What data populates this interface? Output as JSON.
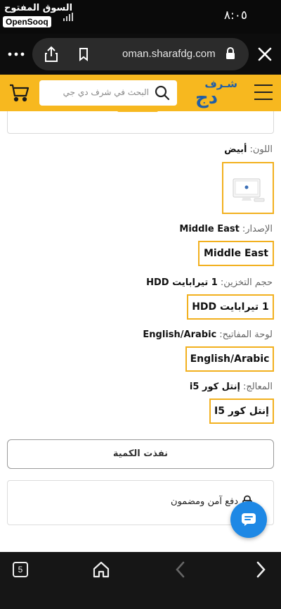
{
  "status_bar": {
    "watermark_arabic": "السوق المفتوح",
    "watermark_english": "OpenSooq",
    "time": "٨:٠٥"
  },
  "browser": {
    "url": "oman.sharafdg.com",
    "more_icon": "more-horizontal-icon",
    "share_icon": "share-icon",
    "bookmark_icon": "bookmark-icon",
    "lock_icon": "lock-icon",
    "close_icon": "close-icon"
  },
  "site_header": {
    "search_placeholder": "البحث في شرف دي جي",
    "logo_top": "شـرف",
    "logo_main": "دج",
    "accent_color": "#f7b81f",
    "logo_color": "#1f5ea8"
  },
  "options": {
    "color": {
      "label": "اللون:",
      "value": "أبيض"
    },
    "edition": {
      "label": "الإصدار:",
      "value": "Middle East",
      "chip": "Middle East"
    },
    "storage": {
      "label": "حجم التخزين:",
      "value": "1 تيرابايت HDD",
      "chip": "1 تيرابايت HDD"
    },
    "keyboard": {
      "label": "لوحة المفاتيح:",
      "value": "English/Arabic",
      "chip": "English/Arabic"
    },
    "processor": {
      "label": "المعالج:",
      "value": "إنتل كور i5",
      "chip": "إنتل كور I5"
    }
  },
  "out_of_stock_label": "نفذت الكمية",
  "secure_payment_text": "دفع آمن ومضمون",
  "chat_icon": "chat-icon",
  "bottom_nav": {
    "tab_count": "5",
    "home_icon": "home-icon",
    "back_icon": "chevron-left-icon",
    "forward_icon": "chevron-right-icon"
  }
}
